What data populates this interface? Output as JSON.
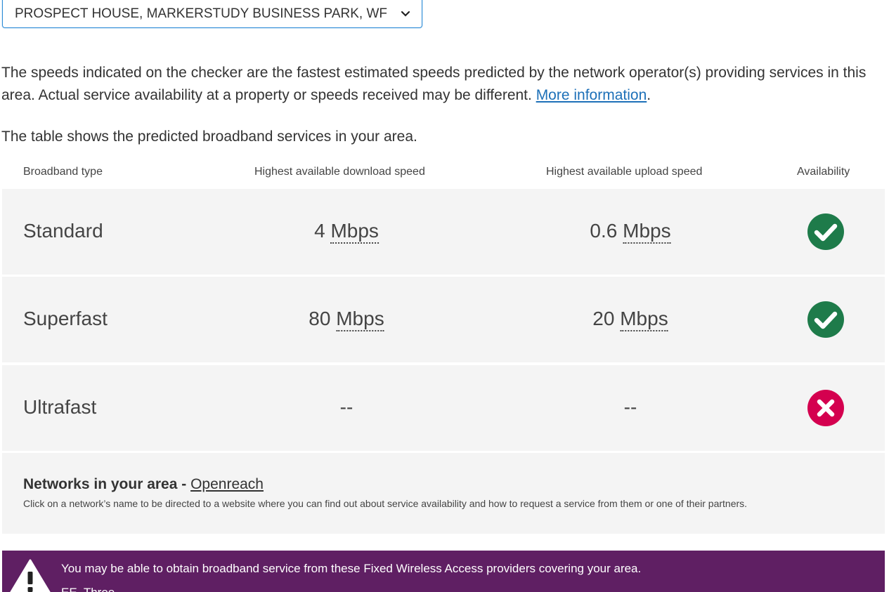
{
  "address_select": {
    "value": "PROSPECT HOUSE, MARKERSTUDY BUSINESS PARK, WF"
  },
  "intro": {
    "text": "The speeds indicated on the checker are the fastest estimated speeds predicted by the network operator(s) providing services in this area. Actual service availability at a property or speeds received may be different. ",
    "link": "More information",
    "suffix": "."
  },
  "table_intro": "The table shows the predicted broadband services in your area.",
  "table": {
    "headers": {
      "type": "Broadband type",
      "download": "Highest available download speed",
      "upload": "Highest available upload speed",
      "availability": "Availability"
    },
    "rows": [
      {
        "type": "Standard",
        "download_value": "4",
        "download_unit": "Mbps",
        "upload_value": "0.6",
        "upload_unit": "Mbps",
        "available": true
      },
      {
        "type": "Superfast",
        "download_value": "80",
        "download_unit": "Mbps",
        "upload_value": "20",
        "upload_unit": "Mbps",
        "available": true
      },
      {
        "type": "Ultrafast",
        "download_value": "--",
        "download_unit": "",
        "upload_value": "--",
        "upload_unit": "",
        "available": false
      }
    ]
  },
  "networks": {
    "label": "Networks in your area - ",
    "link": "Openreach",
    "note": "Click on a network’s name to be directed to a website where you can find out about service availability and how to request a service from them or one of their partners."
  },
  "fwa": {
    "text": "You may be able to obtain broadband service from these Fixed Wireless Access providers covering your area.",
    "providers": "EE, Three"
  },
  "colors": {
    "available": "#1e7b4a",
    "unavailable": "#d4004f",
    "banner": "#5f1f63",
    "link": "#1d70b8"
  },
  "icons": {
    "select": "chevron-down-icon",
    "available": "check-circle-icon",
    "unavailable": "cross-circle-icon",
    "banner": "warning-icon"
  }
}
